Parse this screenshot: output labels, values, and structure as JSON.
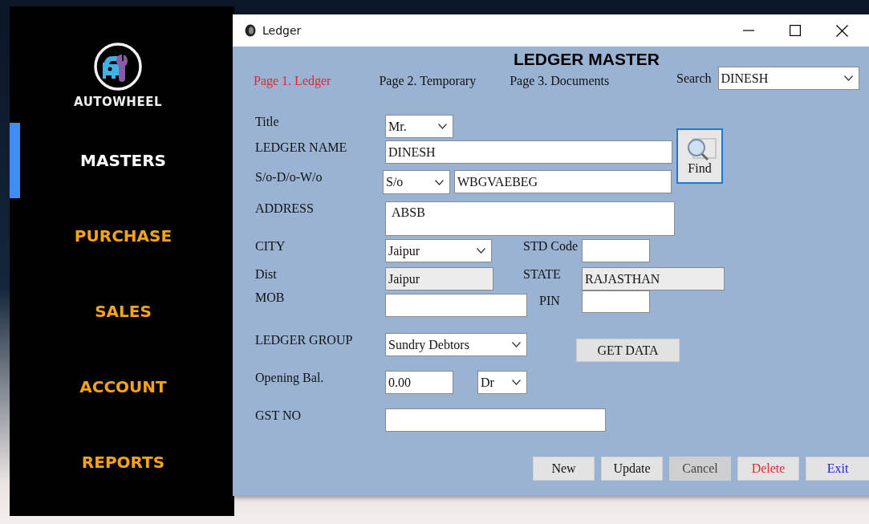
{
  "sidebar": {
    "brand": "AUTOWHEEL",
    "items": [
      {
        "label": "MASTERS",
        "selected": true
      },
      {
        "label": "PURCHASE",
        "selected": false
      },
      {
        "label": "SALES",
        "selected": false
      },
      {
        "label": "ACCOUNT",
        "selected": false
      },
      {
        "label": "REPORTS",
        "selected": false
      }
    ]
  },
  "window": {
    "title": "Ledger"
  },
  "heading": "LEDGER MASTER",
  "tabs": [
    {
      "label": "Page 1. Ledger",
      "selected": true
    },
    {
      "label": "Page 2. Temporary",
      "selected": false
    },
    {
      "label": "Page 3. Documents",
      "selected": false
    }
  ],
  "search": {
    "label": "Search",
    "value": "DINESH"
  },
  "form": {
    "title": {
      "label": "Title",
      "value": "Mr."
    },
    "ledger_name": {
      "label": "LEDGER NAME",
      "value": "DINESH"
    },
    "relation": {
      "label": "S/o-D/o-W/o",
      "value": "S/o"
    },
    "relation_name": {
      "value": "WBGVAEBEG"
    },
    "address": {
      "label": "ADDRESS",
      "value": "ABSB"
    },
    "city": {
      "label": "CITY",
      "value": "Jaipur"
    },
    "std_code": {
      "label": "STD Code"
    },
    "dist": {
      "label": "Dist",
      "value": "Jaipur",
      "disabled": true
    },
    "state": {
      "label": "STATE",
      "value": "RAJASTHAN",
      "disabled": true
    },
    "mob": {
      "label": "MOB"
    },
    "pin": {
      "label": "PIN"
    },
    "ledger_group": {
      "label": "LEDGER GROUP",
      "value": "Sundry Debtors"
    },
    "opening_bal": {
      "label": "Opening Bal.",
      "value": "0.00"
    },
    "balance_type": {
      "value": "Dr"
    },
    "gst_no": {
      "label": "GST NO"
    }
  },
  "find_button": "Find",
  "get_data_button": "GET DATA",
  "buttons": [
    {
      "label": "New",
      "kind": "default",
      "disabled": false
    },
    {
      "label": "Update",
      "kind": "default",
      "disabled": false
    },
    {
      "label": "Cancel",
      "kind": "default",
      "disabled": true
    },
    {
      "label": "Delete",
      "kind": "danger",
      "disabled": false
    },
    {
      "label": "Exit",
      "kind": "exit",
      "disabled": false
    }
  ]
}
